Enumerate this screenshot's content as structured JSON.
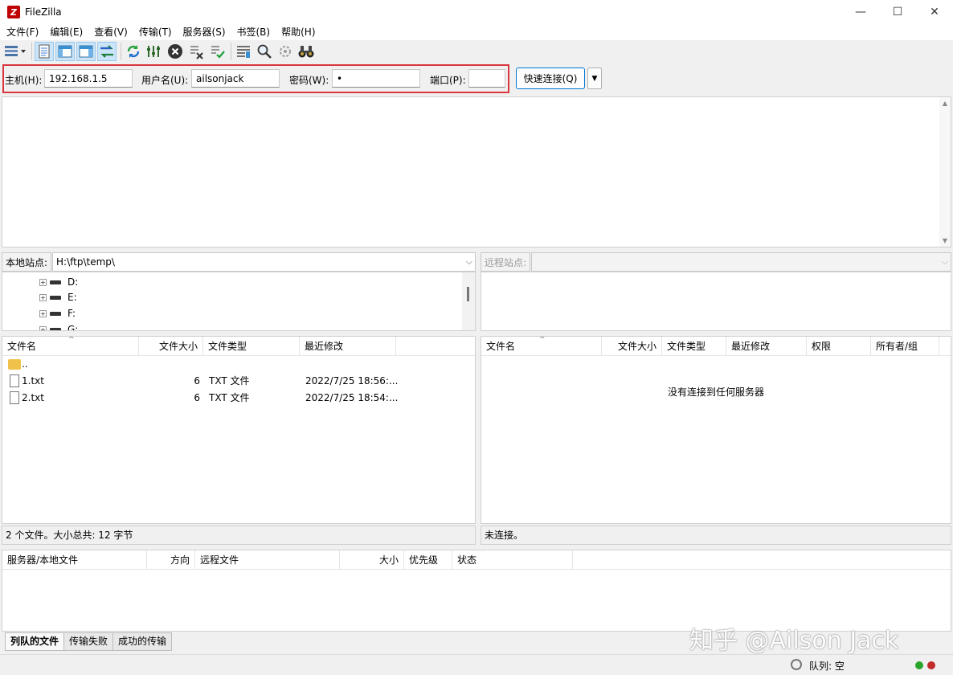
{
  "window": {
    "title": "FileZilla",
    "logo_letter": "Z",
    "minimize": "—",
    "maximize": "☐",
    "close": "✕"
  },
  "menu": [
    "文件(F)",
    "编辑(E)",
    "查看(V)",
    "传输(T)",
    "服务器(S)",
    "书签(B)",
    "帮助(H)"
  ],
  "toolbar": {
    "icons": [
      "site-manager-icon",
      "toggle-message-log-icon",
      "toggle-local-tree-icon",
      "toggle-remote-tree-icon",
      "toggle-transfer-queue-icon",
      "refresh-icon",
      "process-queue-icon",
      "cancel-icon",
      "disconnect-icon",
      "reconnect-icon",
      "directory-listing-filters-icon",
      "toggle-sync-browsing-icon",
      "directory-comparison-icon",
      "search-icon"
    ]
  },
  "quickconnect": {
    "host_label": "主机(H):",
    "host_value": "192.168.1.5",
    "user_label": "用户名(U):",
    "user_value": "ailsonjack",
    "pass_label": "密码(W):",
    "pass_value": "•",
    "port_label": "端口(P):",
    "port_value": "",
    "connect_label": "快速连接(Q)"
  },
  "local": {
    "site_label": "本地站点:",
    "path": "H:\\ftp\\temp\\",
    "tree": [
      "D:",
      "E:",
      "F:",
      "G:"
    ],
    "columns": [
      "文件名",
      "文件大小",
      "文件类型",
      "最近修改"
    ],
    "rows": [
      {
        "name": "..",
        "size": "",
        "type": "",
        "modified": ""
      },
      {
        "name": "1.txt",
        "size": "6",
        "type": "TXT 文件",
        "modified": "2022/7/25 18:56:..."
      },
      {
        "name": "2.txt",
        "size": "6",
        "type": "TXT 文件",
        "modified": "2022/7/25 18:54:..."
      }
    ],
    "status": "2 个文件。大小总共: 12 字节"
  },
  "remote": {
    "site_label": "远程站点:",
    "path": "",
    "columns": [
      "文件名",
      "文件大小",
      "文件类型",
      "最近修改",
      "权限",
      "所有者/组"
    ],
    "empty_message": "没有连接到任何服务器",
    "status": "未连接。"
  },
  "queue": {
    "columns": [
      "服务器/本地文件",
      "方向",
      "远程文件",
      "大小",
      "优先级",
      "状态"
    ],
    "tabs": [
      "列队的文件",
      "传输失败",
      "成功的传输"
    ],
    "queue_status": "队列: 空"
  },
  "colors": {
    "highlight_outline": "#d9363e",
    "led_green": "#2aa52a",
    "led_red": "#c42b2b",
    "accent": "#0078d4"
  },
  "watermark": "知乎 @Ailson Jack"
}
